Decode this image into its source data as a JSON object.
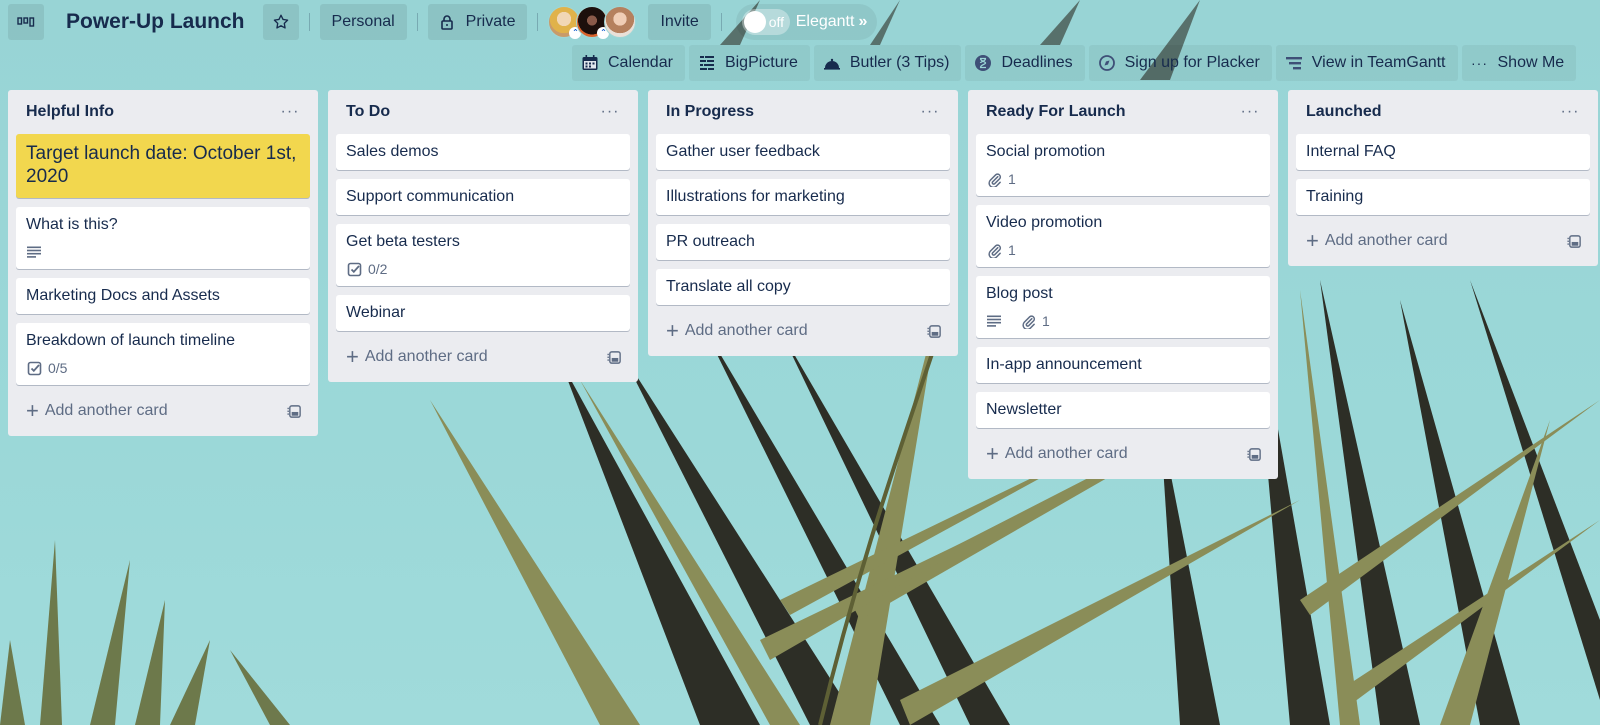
{
  "header": {
    "board_title": "Power-Up Launch",
    "buttons": {
      "personal": "Personal",
      "private": "Private",
      "invite": "Invite"
    },
    "members": [
      {
        "name": "member-1",
        "color": "#d9a85a",
        "has_badge": true
      },
      {
        "name": "member-2",
        "color": "#3b1a16",
        "has_badge": true
      },
      {
        "name": "member-3",
        "color": "#c8977a",
        "has_badge": false
      }
    ],
    "elegantt": {
      "toggle_state": "off",
      "label": "Elegantt",
      "chevron": "»"
    }
  },
  "powerups": [
    {
      "label": "Calendar",
      "icon": "calendar-icon"
    },
    {
      "label": "BigPicture",
      "icon": "bigpicture-icon"
    },
    {
      "label": "Butler (3 Tips)",
      "icon": "butler-bell-icon"
    },
    {
      "label": "Deadlines",
      "icon": "hourglass-icon"
    },
    {
      "label": "Sign up for Placker",
      "icon": "placker-icon"
    },
    {
      "label": "View in TeamGantt",
      "icon": "teamgantt-icon"
    },
    {
      "label": "Show Me",
      "icon": "more-icon"
    }
  ],
  "lists": [
    {
      "title": "Helpful Info",
      "cards": [
        {
          "title": "Target launch date: October 1st, 2020",
          "color": "yellow",
          "badges": []
        },
        {
          "title": "What is this?",
          "badges": [
            {
              "type": "description"
            }
          ]
        },
        {
          "title": "Marketing Docs and Assets",
          "badges": []
        },
        {
          "title": "Breakdown of launch timeline",
          "badges": [
            {
              "type": "checklist",
              "value": "0/5"
            }
          ]
        }
      ],
      "add_label": "Add another card"
    },
    {
      "title": "To Do",
      "cards": [
        {
          "title": "Sales demos",
          "badges": []
        },
        {
          "title": "Support communication",
          "badges": []
        },
        {
          "title": "Get beta testers",
          "badges": [
            {
              "type": "checklist",
              "value": "0/2"
            }
          ]
        },
        {
          "title": "Webinar",
          "badges": []
        }
      ],
      "add_label": "Add another card"
    },
    {
      "title": "In Progress",
      "cards": [
        {
          "title": "Gather user feedback",
          "badges": []
        },
        {
          "title": "Illustrations for marketing",
          "badges": []
        },
        {
          "title": "PR outreach",
          "badges": []
        },
        {
          "title": "Translate all copy",
          "badges": []
        }
      ],
      "add_label": "Add another card"
    },
    {
      "title": "Ready For Launch",
      "cards": [
        {
          "title": "Social promotion",
          "badges": [
            {
              "type": "attachment",
              "value": "1"
            }
          ]
        },
        {
          "title": "Video promotion",
          "badges": [
            {
              "type": "attachment",
              "value": "1"
            }
          ]
        },
        {
          "title": "Blog post",
          "badges": [
            {
              "type": "description"
            },
            {
              "type": "attachment",
              "value": "1"
            }
          ]
        },
        {
          "title": "In-app announcement",
          "badges": []
        },
        {
          "title": "Newsletter",
          "badges": []
        }
      ],
      "add_label": "Add another card"
    },
    {
      "title": "Launched",
      "cards": [
        {
          "title": "Internal FAQ",
          "badges": []
        },
        {
          "title": "Training",
          "badges": []
        }
      ],
      "add_label": "Add another card"
    }
  ],
  "colors": {
    "background": "#9bd6d6",
    "list_bg": "#ebecf0",
    "card_bg": "#ffffff",
    "yellow_label": "#f2d74e",
    "text": "#172b4d",
    "muted": "#5e6c84"
  }
}
